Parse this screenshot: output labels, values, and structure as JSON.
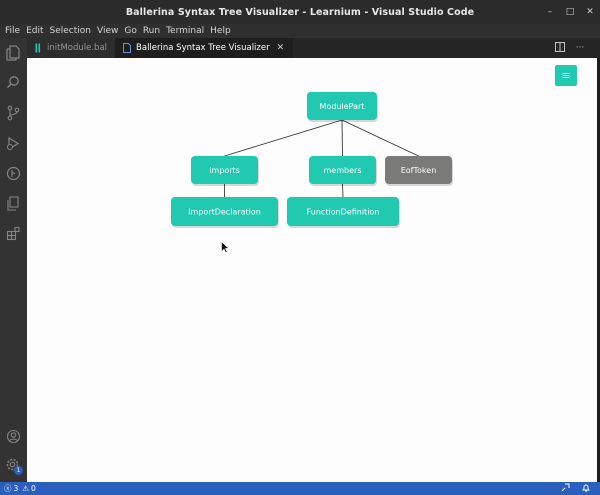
{
  "window": {
    "title": "Ballerina Syntax Tree Visualizer - Learnium - Visual Studio Code",
    "controls": {
      "minimize": "–",
      "maximize": "□",
      "close": "✕"
    }
  },
  "menu": [
    "File",
    "Edit",
    "Selection",
    "View",
    "Go",
    "Run",
    "Terminal",
    "Help"
  ],
  "tabs": [
    {
      "label": "initModule.bal",
      "icon": "ballerina-file-icon",
      "active": false
    },
    {
      "label": "Ballerina Syntax Tree Visualizer",
      "icon": "preview-file-icon",
      "active": true
    }
  ],
  "tab_close": "✕",
  "activity_bar": [
    "explorer-icon",
    "search-icon",
    "source-control-icon",
    "run-debug-icon",
    "ballerina-icon",
    "copy-icon",
    "extensions-icon",
    "account-icon",
    "settings-gear-icon"
  ],
  "settings_badge": "1",
  "visualizer": {
    "menu_button": "≡",
    "nodes": [
      {
        "id": "root",
        "label": "ModulePart",
        "color": "#20c9b0"
      },
      {
        "id": "imports",
        "label": "imports",
        "color": "#20c9b0"
      },
      {
        "id": "members",
        "label": "members",
        "color": "#20c9b0"
      },
      {
        "id": "eof",
        "label": "EofToken",
        "color": "#7a7a78"
      },
      {
        "id": "importdecl",
        "label": "ImportDeclaration",
        "color": "#20c9b0"
      },
      {
        "id": "funcdef",
        "label": "FunctionDefinition",
        "color": "#20c9b0"
      }
    ],
    "edges": [
      [
        "root",
        "imports"
      ],
      [
        "root",
        "members"
      ],
      [
        "root",
        "eof"
      ],
      [
        "imports",
        "importdecl"
      ],
      [
        "members",
        "funcdef"
      ]
    ]
  },
  "status": {
    "errors": "3",
    "warnings": "0"
  },
  "colors": {
    "accent": "#20c9b0",
    "leaf_gray": "#7a7a78",
    "statusbar": "#2b5fbd"
  }
}
